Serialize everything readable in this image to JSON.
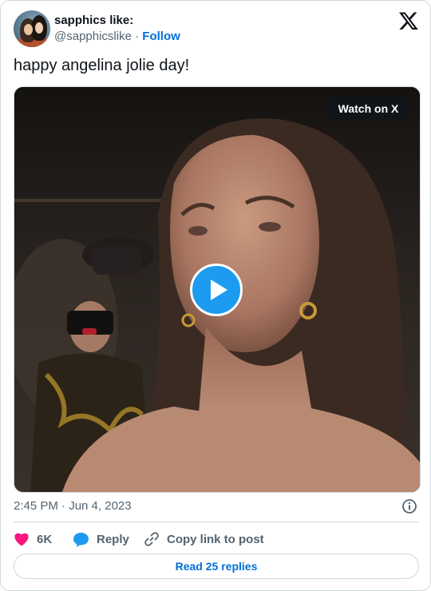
{
  "user": {
    "display_name": "sapphics like:",
    "handle": "@sapphicslike",
    "separator": "·",
    "follow_label": "Follow"
  },
  "tweet": {
    "text": "happy angelina jolie day!",
    "timestamp": "2:45 PM · Jun 4, 2023"
  },
  "media": {
    "watch_label": "Watch on X",
    "type": "video"
  },
  "actions": {
    "likes_count": "6K",
    "reply_label": "Reply",
    "copy_label": "Copy link to post"
  },
  "footer": {
    "read_replies_label": "Read 25 replies"
  },
  "icons": [
    "x-logo-icon",
    "info-icon",
    "heart-icon",
    "reply-bubble-icon",
    "link-icon",
    "play-icon"
  ],
  "colors": {
    "accent": "#1d9bf0",
    "link": "#006fd6",
    "like": "#f91880",
    "muted": "#536471",
    "text": "#0f1419"
  }
}
